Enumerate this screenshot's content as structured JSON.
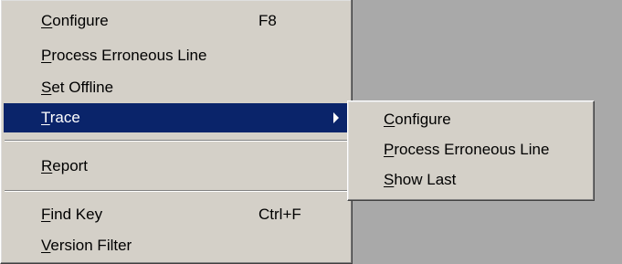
{
  "colors": {
    "menu_bg": "#d4d0c8",
    "highlight_bg": "#0a246a",
    "highlight_text": "#ffffff",
    "backdrop": "#a9a9a9"
  },
  "main_menu": {
    "items": [
      {
        "mnemonic": "C",
        "rest": "onfigure",
        "shortcut": "F8"
      },
      {
        "mnemonic": "P",
        "rest": "rocess Erroneous Line",
        "shortcut": ""
      },
      {
        "mnemonic": "S",
        "rest": "et Offline",
        "shortcut": ""
      },
      {
        "mnemonic": "T",
        "rest": "race",
        "shortcut": "",
        "submenu_icon": "submenu-arrow-icon",
        "highlighted": true
      },
      {
        "mnemonic": "R",
        "rest": "eport",
        "shortcut": ""
      },
      {
        "mnemonic": "F",
        "rest": "ind Key",
        "shortcut": "Ctrl+F"
      },
      {
        "mnemonic": "V",
        "rest": "ersion Filter",
        "shortcut": ""
      }
    ]
  },
  "trace_submenu": {
    "items": [
      {
        "mnemonic": "C",
        "rest": "onfigure"
      },
      {
        "mnemonic": "P",
        "rest": "rocess Erroneous Line"
      },
      {
        "mnemonic": "S",
        "rest": "how Last"
      }
    ]
  }
}
